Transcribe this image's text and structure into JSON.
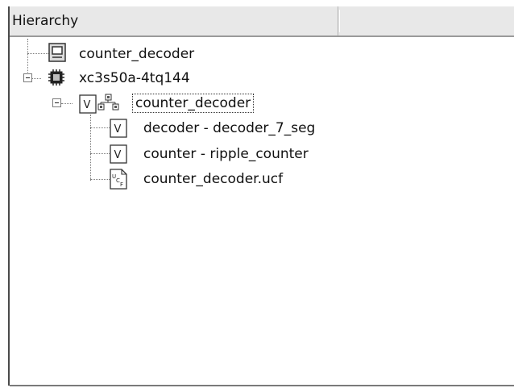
{
  "header": {
    "title": "Hierarchy"
  },
  "tree": {
    "items": [
      {
        "label": "counter_decoder",
        "icon": "project-file-icon"
      },
      {
        "label": "xc3s50a-4tq144",
        "icon": "fpga-chip-icon",
        "expanded": true
      },
      {
        "label": "counter_decoder",
        "icon": "verilog-top-module-icon",
        "expanded": true,
        "focused": true
      },
      {
        "label": "decoder - decoder_7_seg",
        "icon": "verilog-file-icon"
      },
      {
        "label": "counter - ripple_counter",
        "icon": "verilog-file-icon"
      },
      {
        "label": "counter_decoder.ucf",
        "icon": "ucf-constraints-file-icon"
      }
    ]
  }
}
